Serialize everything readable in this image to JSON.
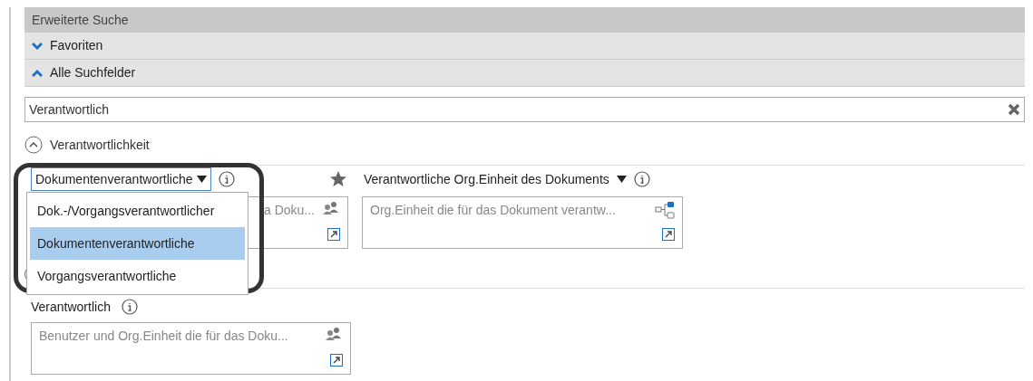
{
  "panel_title": "Erweiterte Suche",
  "sections": [
    {
      "label": "Favoriten",
      "expanded": false
    },
    {
      "label": "Alle Suchfelder",
      "expanded": true
    }
  ],
  "search": {
    "value": "Verantwortlich"
  },
  "group": {
    "label": "Verantwortlichkeit",
    "expanded": true
  },
  "fields_row": [
    {
      "label": "Dokumentenverantwortliche",
      "placeholder": "a Doku...",
      "kind": "people"
    },
    {
      "label": "Verantwortliche Org.Einheit des Dokuments",
      "placeholder": "Org.Einheit die für das Dokument verantw...",
      "kind": "org",
      "starred": true
    }
  ],
  "field_bottom": {
    "label": "Verantwortlich",
    "placeholder": "Benutzer und Org.Einheit die für das Doku...",
    "kind": "people"
  },
  "dropdown_options": [
    {
      "label": "Dok.-/Vorgangsverantwortlicher",
      "selected": false
    },
    {
      "label": "Dokumentenverantwortliche",
      "selected": true
    },
    {
      "label": "Vorgangsverantwortliche",
      "selected": false
    }
  ]
}
